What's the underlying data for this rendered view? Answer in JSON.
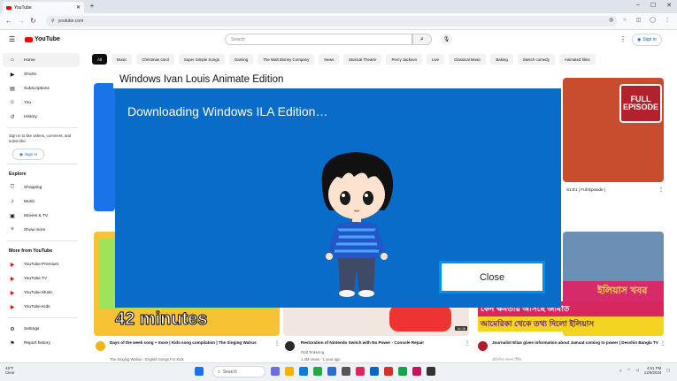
{
  "browser": {
    "tab_title": "YouTube",
    "url": "youtube.com"
  },
  "youtube": {
    "logo_text": "YouTube",
    "search_placeholder": "Search",
    "sign_in": "Sign in",
    "chips": [
      "All",
      "Music",
      "Christmas carol",
      "Super Simple Songs",
      "Gaming",
      "The Walt Disney Company",
      "News",
      "Musical Theatre",
      "Percy Jackson",
      "Live",
      "Classical Music",
      "Baking",
      "Sketch comedy",
      "Animated films"
    ],
    "sidebar": {
      "main": [
        {
          "label": "Home",
          "icon": "home-icon"
        },
        {
          "label": "Shorts",
          "icon": "shorts-icon"
        },
        {
          "label": "Subscriptions",
          "icon": "subscriptions-icon"
        },
        {
          "label": "You",
          "icon": "you-icon"
        },
        {
          "label": "History",
          "icon": "history-icon"
        }
      ],
      "signin_message": "Sign in to like videos, comment, and subscribe.",
      "signin_button": "Sign in",
      "explore_title": "Explore",
      "explore": [
        {
          "label": "Shopping",
          "icon": "shopping-icon"
        },
        {
          "label": "Music",
          "icon": "music-icon"
        },
        {
          "label": "Movies & TV",
          "icon": "movies-icon"
        },
        {
          "label": "Show more",
          "icon": "chevron-down-icon"
        }
      ],
      "more_title": "More from YouTube",
      "more": [
        {
          "label": "YouTube Premium"
        },
        {
          "label": "YouTube TV"
        },
        {
          "label": "YouTube Music"
        },
        {
          "label": "YouTube Kids"
        }
      ],
      "footer": [
        {
          "label": "Settings",
          "icon": "gear-icon"
        },
        {
          "label": "Report history",
          "icon": "flag-icon"
        }
      ]
    },
    "videos": [
      {
        "title": "Days of the week song + more | Kids song compilation | The Singing Walrus",
        "channel": "The Singing Walrus - English Songs For Kids",
        "duration_overlay": "42 minutes"
      },
      {
        "title": "Restoration of Nintendo Switch with No Power - Console Repair",
        "channel": "Odd Tinkering",
        "stats": "1.4M views · 1 year ago",
        "duration": "18:38"
      },
      {
        "title": "Journalist Elias gives information about Jamaat coming to power | Desshin Bangla TV",
        "channel": "প্রতিদিন বাংলা টিভি",
        "headline": "ইলিয়াস খবর",
        "band_text": "কেন ক্ষমতায় আসছে জামাত",
        "yellow_text": "আমেরিকা থেকে তথ্য দিলো ইলিয়াস"
      },
      {
        "caption": "S1 E1 | Full Episode |",
        "badge_line1": "FULL",
        "badge_line2": "EPISODE"
      }
    ]
  },
  "modal": {
    "title": "Windows Ivan Louis Animate Edition",
    "heading": "Downloading Windows ILA Edition…",
    "close_label": "Close",
    "colors": {
      "body": "#0a6cc9",
      "button_border": "#0091ea"
    }
  },
  "taskbar": {
    "weather_temp": "48°F",
    "weather_desc": "Clear",
    "search_placeholder": "Search",
    "time": "4:51 PM",
    "date": "12/8/2024"
  }
}
